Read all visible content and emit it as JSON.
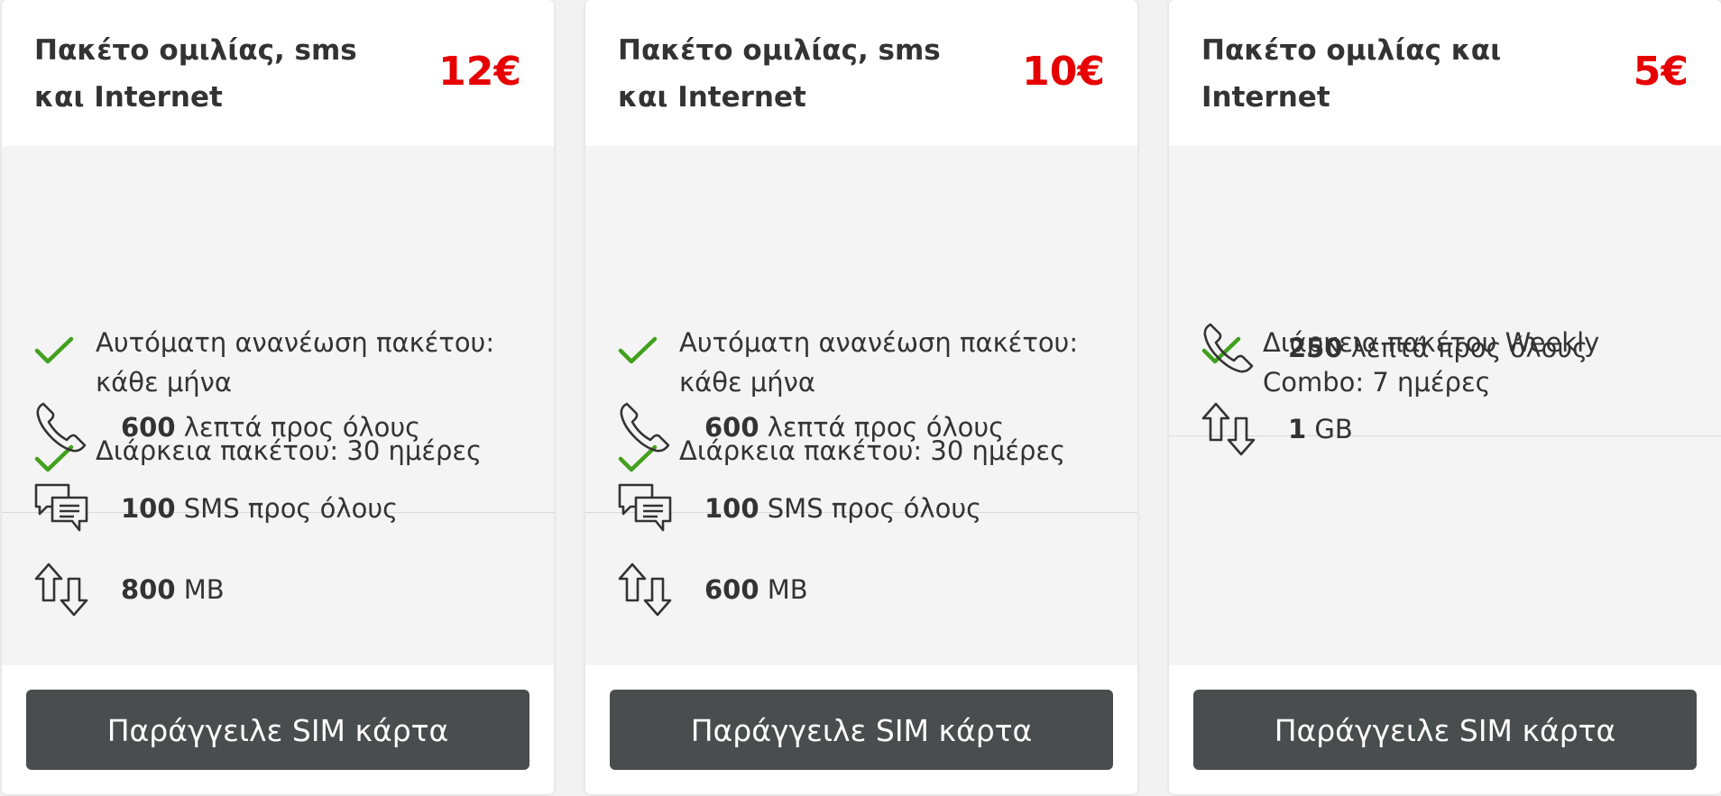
{
  "colors": {
    "price": "#e60000",
    "check": "#43a01e",
    "button": "#4a4d4e"
  },
  "plans": [
    {
      "title": "Πακέτο ομιλίας, sms και Internet",
      "price": "12€",
      "features": [
        {
          "icon": "check-icon",
          "text": "Αυτόματη ανανέωση πακέτου: κάθε μήνα"
        },
        {
          "icon": "check-icon",
          "text": "Διάρκεια πακέτου: 30 ημέρες"
        }
      ],
      "allowances": [
        {
          "icon": "phone-icon",
          "amount": "600",
          "unit": "λεπτά προς όλους"
        },
        {
          "icon": "sms-icon",
          "amount": "100",
          "unit": "SMS προς όλους"
        },
        {
          "icon": "data-icon",
          "amount": "800",
          "unit": "MB"
        }
      ],
      "button_label": "Παράγγειλε SIM κάρτα"
    },
    {
      "title": "Πακέτο ομιλίας, sms και Internet",
      "price": "10€",
      "features": [
        {
          "icon": "check-icon",
          "text": "Αυτόματη ανανέωση πακέτου: κάθε μήνα"
        },
        {
          "icon": "check-icon",
          "text": "Διάρκεια πακέτου: 30 ημέρες"
        }
      ],
      "allowances": [
        {
          "icon": "phone-icon",
          "amount": "600",
          "unit": "λεπτά προς όλους"
        },
        {
          "icon": "sms-icon",
          "amount": "100",
          "unit": "SMS προς όλους"
        },
        {
          "icon": "data-icon",
          "amount": "600",
          "unit": "MB"
        }
      ],
      "button_label": "Παράγγειλε SIM κάρτα"
    },
    {
      "title": "Πακέτο ομιλίας και Internet",
      "price": "5€",
      "features": [
        {
          "icon": "check-icon",
          "text": "Διάρκεια πακέτου Weekly Combo: 7 ημέρες"
        }
      ],
      "allowances": [
        {
          "icon": "phone-icon",
          "amount": "250",
          "unit": "λεπτά προς όλους"
        },
        {
          "icon": "data-icon",
          "amount": "1",
          "unit": "GB"
        }
      ],
      "button_label": "Παράγγειλε SIM κάρτα"
    }
  ]
}
